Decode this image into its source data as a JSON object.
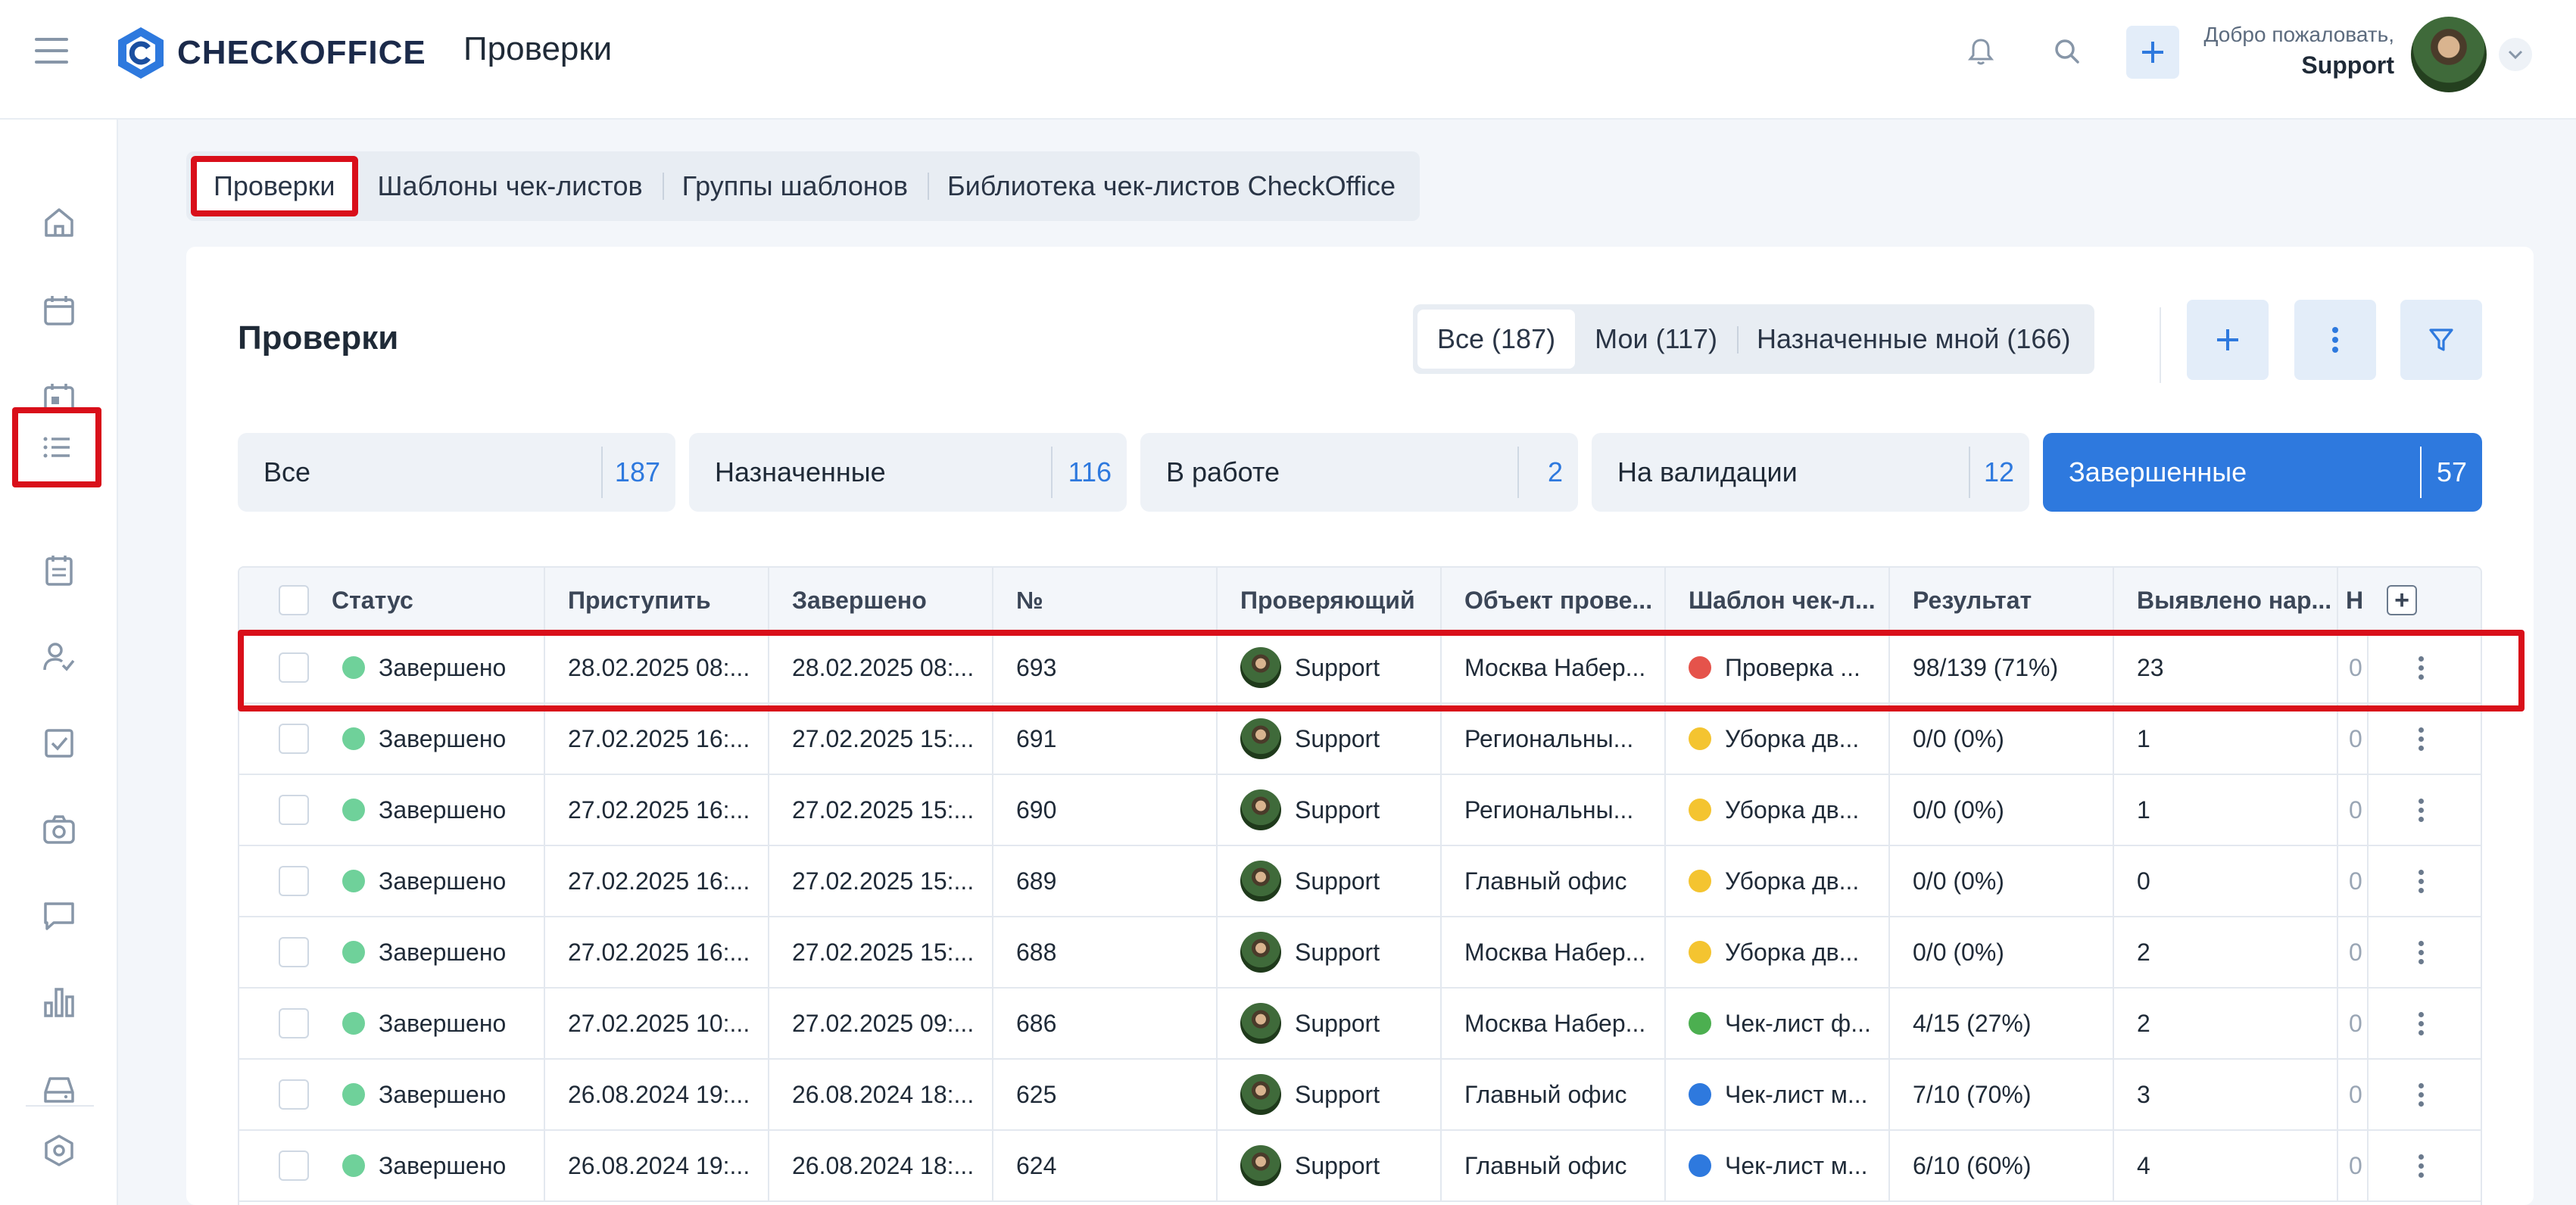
{
  "header": {
    "logo_text": "CHECKOFFICE",
    "page_title": "Проверки",
    "welcome_line": "Добро пожаловать,",
    "user_name": "Support"
  },
  "sidebar": {
    "items": [
      "home-icon",
      "calendar-icon",
      "calendar-today-icon",
      "list-icon",
      "clipboard-icon",
      "user-check-icon",
      "checkbox-icon",
      "camera-icon",
      "chat-icon",
      "chart-icon",
      "inbox-icon",
      "settings-hex-icon"
    ],
    "active": "list-icon"
  },
  "page_tabs": [
    {
      "label": "Проверки",
      "active": true
    },
    {
      "label": "Шаблоны чек-листов",
      "active": false
    },
    {
      "label": "Группы шаблонов",
      "active": false
    },
    {
      "label": "Библиотека чек-листов CheckOffice",
      "active": false
    }
  ],
  "card": {
    "title": "Проверки",
    "scope_tabs": [
      {
        "label": "Все (187)",
        "active": true
      },
      {
        "label": "Мои (117)",
        "active": false
      },
      {
        "label": "Назначенные мной (166)",
        "active": false
      }
    ],
    "status_tiles": [
      {
        "label": "Все",
        "count": "187",
        "active": false
      },
      {
        "label": "Назначенные",
        "count": "116",
        "active": false
      },
      {
        "label": "В работе",
        "count": "2",
        "active": false
      },
      {
        "label": "На валидации",
        "count": "12",
        "active": false
      },
      {
        "label": "Завершенные",
        "count": "57",
        "active": true
      }
    ]
  },
  "table": {
    "columns": [
      "Статус",
      "Приступить",
      "Завершено",
      "№",
      "Проверяющий",
      "Объект прове...",
      "Шаблон чек-л...",
      "Результат",
      "Выявлено нар...",
      "Н"
    ],
    "rows": [
      {
        "status": "Завершено",
        "start": "28.02.2025 08:...",
        "end": "28.02.2025 08:...",
        "num": "693",
        "inspector": "Support",
        "object": "Москва Набер...",
        "template_color": "#e5534b",
        "template": "Проверка ...",
        "result": "98/139 (71%)",
        "violations": "23",
        "extra": "0"
      },
      {
        "status": "Завершено",
        "start": "27.02.2025 16:...",
        "end": "27.02.2025 15:...",
        "num": "691",
        "inspector": "Support",
        "object": "Региональны...",
        "template_color": "#f4c430",
        "template": "Уборка дв...",
        "result": "0/0 (0%)",
        "violations": "1",
        "extra": "0"
      },
      {
        "status": "Завершено",
        "start": "27.02.2025 16:...",
        "end": "27.02.2025 15:...",
        "num": "690",
        "inspector": "Support",
        "object": "Региональны...",
        "template_color": "#f4c430",
        "template": "Уборка дв...",
        "result": "0/0 (0%)",
        "violations": "1",
        "extra": "0"
      },
      {
        "status": "Завершено",
        "start": "27.02.2025 16:...",
        "end": "27.02.2025 15:...",
        "num": "689",
        "inspector": "Support",
        "object": "Главный офис",
        "template_color": "#f4c430",
        "template": "Уборка дв...",
        "result": "0/0 (0%)",
        "violations": "0",
        "extra": "0"
      },
      {
        "status": "Завершено",
        "start": "27.02.2025 16:...",
        "end": "27.02.2025 15:...",
        "num": "688",
        "inspector": "Support",
        "object": "Москва Набер...",
        "template_color": "#f4c430",
        "template": "Уборка дв...",
        "result": "0/0 (0%)",
        "violations": "2",
        "extra": "0"
      },
      {
        "status": "Завершено",
        "start": "27.02.2025 10:...",
        "end": "27.02.2025 09:...",
        "num": "686",
        "inspector": "Support",
        "object": "Москва Набер...",
        "template_color": "#4caf50",
        "template": "Чек-лист ф...",
        "result": "4/15 (27%)",
        "violations": "2",
        "extra": "0"
      },
      {
        "status": "Завершено",
        "start": "26.08.2024 19:...",
        "end": "26.08.2024 18:...",
        "num": "625",
        "inspector": "Support",
        "object": "Главный офис",
        "template_color": "#2e79de",
        "template": "Чек-лист м...",
        "result": "7/10 (70%)",
        "violations": "3",
        "extra": "0"
      },
      {
        "status": "Завершено",
        "start": "26.08.2024 19:...",
        "end": "26.08.2024 18:...",
        "num": "624",
        "inspector": "Support",
        "object": "Главный офис",
        "template_color": "#2e79de",
        "template": "Чек-лист м...",
        "result": "6/10 (60%)",
        "violations": "4",
        "extra": "0"
      }
    ]
  },
  "colors": {
    "accent": "#2e79de",
    "status_done": "#6fd19a",
    "highlight": "#d90f1a"
  }
}
